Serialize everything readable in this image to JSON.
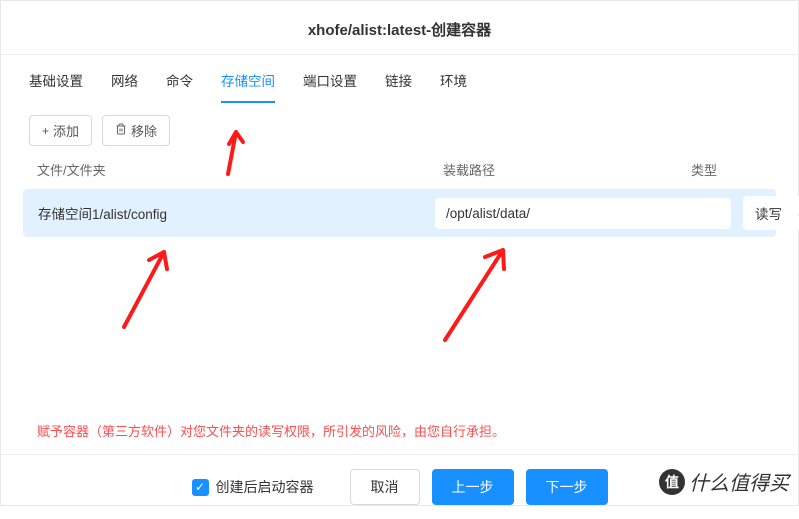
{
  "header": {
    "title": "xhofe/alist:latest-创建容器"
  },
  "tabs": [
    {
      "label": "基础设置",
      "active": false
    },
    {
      "label": "网络",
      "active": false
    },
    {
      "label": "命令",
      "active": false
    },
    {
      "label": "存储空间",
      "active": true
    },
    {
      "label": "端口设置",
      "active": false
    },
    {
      "label": "链接",
      "active": false
    },
    {
      "label": "环境",
      "active": false
    }
  ],
  "toolbar": {
    "add_label": "添加",
    "remove_label": "移除"
  },
  "table": {
    "col_file": "文件/文件夹",
    "col_path": "装载路径",
    "col_type": "类型",
    "rows": [
      {
        "file": "存储空间1/alist/config",
        "path": "/opt/alist/data/",
        "type": "读写"
      }
    ]
  },
  "warning": "赋予容器（第三方软件）对您文件夹的读写权限，所引发的风险，由您自行承担。",
  "footer": {
    "checkbox_label": "创建后启动容器",
    "checkbox_checked": true,
    "cancel": "取消",
    "prev": "上一步",
    "next": "下一步"
  },
  "watermark": "什么值得买"
}
